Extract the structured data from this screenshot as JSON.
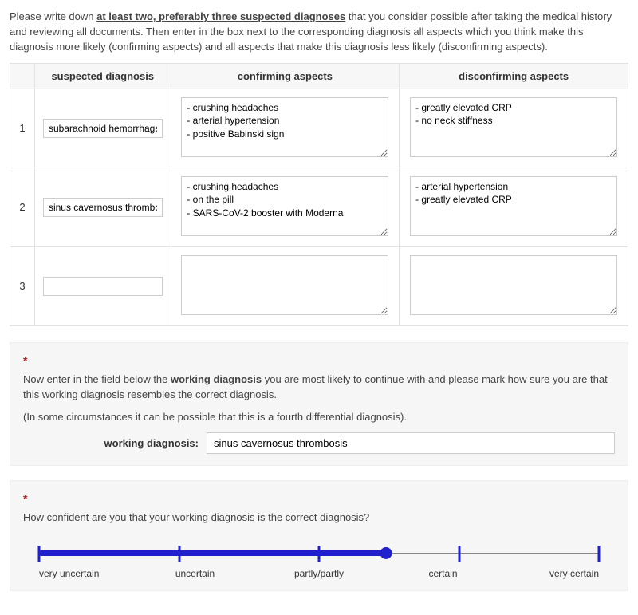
{
  "intro": {
    "before": "Please write down ",
    "underlined": "at least two, preferably three suspected diagnoses",
    "after": " that you consider possible after taking the medical history and reviewing all documents. Then enter in the box next to the corresponding diagnosis all aspects which you think make this diagnosis more likely (confirming aspects) and all aspects that make this diagnosis less likely (disconfirming aspects)."
  },
  "table": {
    "headers": {
      "num": "",
      "diagnosis": "suspected diagnosis",
      "confirming": "confirming aspects",
      "disconfirming": "disconfirming aspects"
    },
    "rows": [
      {
        "num": "1",
        "diagnosis": "subarachnoid hemorrhage",
        "confirming": "- crushing headaches\n- arterial hypertension\n- positive Babinski sign",
        "disconfirming": "- greatly elevated CRP\n- no neck stiffness"
      },
      {
        "num": "2",
        "diagnosis": "sinus cavernosus thrombosis",
        "confirming": "- crushing headaches\n- on the pill\n- SARS-CoV-2 booster with Moderna",
        "disconfirming": "- arterial hypertension\n- greatly elevated CRP"
      },
      {
        "num": "3",
        "diagnosis": "",
        "confirming": "",
        "disconfirming": ""
      }
    ]
  },
  "asterisk": "*",
  "working_block": {
    "text_before": "Now enter in the field below the ",
    "text_underlined": "working diagnosis",
    "text_after": " you are most likely to continue with and please mark how sure you are that this working diagnosis resembles the correct diagnosis.",
    "note": "(In some circumstances it can be possible that this is a fourth differential diagnosis).",
    "label": "working diagnosis:",
    "value": "sinus cavernosus thrombosis"
  },
  "confidence_block": {
    "question": "How confident are you that your working diagnosis is the correct diagnosis?",
    "labels": [
      "very uncertain",
      "uncertain",
      "partly/partly",
      "certain",
      "very certain"
    ],
    "value_percent": 62
  }
}
